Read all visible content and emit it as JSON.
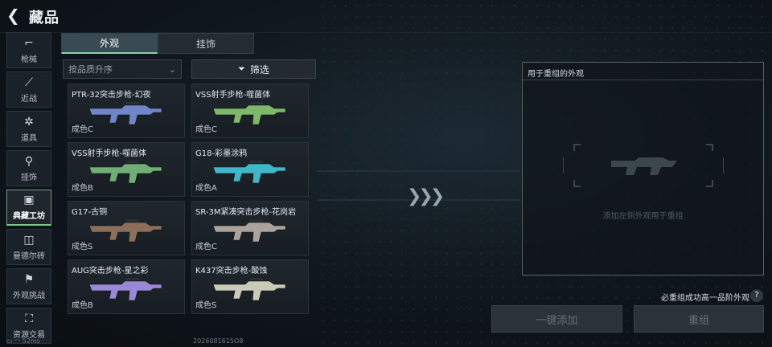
{
  "header": {
    "back_icon": "chevron-left-icon",
    "title": "藏品"
  },
  "sidebar": {
    "items": [
      {
        "label": "枪械",
        "icon": "pistol-icon",
        "glyph": "⌐"
      },
      {
        "label": "近战",
        "icon": "knife-icon",
        "glyph": "⟋"
      },
      {
        "label": "道具",
        "icon": "grenades-icon",
        "glyph": "✲"
      },
      {
        "label": "挂饰",
        "icon": "charm-icon",
        "glyph": "⚲"
      },
      {
        "label": "典藏工坊",
        "icon": "workshop-icon",
        "glyph": "▣"
      },
      {
        "label": "曼德尔砖",
        "icon": "brick-icon",
        "glyph": "◫"
      },
      {
        "label": "外观挑战",
        "icon": "challenge-icon",
        "glyph": "⚑"
      },
      {
        "label": "资源交易",
        "icon": "trade-icon",
        "glyph": "⛶"
      }
    ],
    "active_index": 4
  },
  "tabs": [
    {
      "label": "外观"
    },
    {
      "label": "挂饰"
    }
  ],
  "sort": {
    "value": "按品质升序"
  },
  "filter": {
    "label": "筛选"
  },
  "items": [
    {
      "name": "PTR-32突击步枪-幻夜",
      "quality": "成色C",
      "color": "#6f86c9"
    },
    {
      "name": "VSS射手步枪-噬菌体",
      "quality": "成色C",
      "color": "#7fb86b"
    },
    {
      "name": "VSS射手步枪-噬菌体",
      "quality": "成色B",
      "color": "#6fae76"
    },
    {
      "name": "G18-彩墨涂鸦",
      "quality": "成色A",
      "color": "#3fb7c8"
    },
    {
      "name": "G17-古铜",
      "quality": "成色S",
      "color": "#8c6e5a"
    },
    {
      "name": "SR-3M紧凑突击步枪-花岗岩",
      "quality": "成色C",
      "color": "#a9a39b"
    },
    {
      "name": "AUG突击步枪-星之彩",
      "quality": "成色B",
      "color": "#9a88d6"
    },
    {
      "name": "K437突击步枪-酸蚀",
      "quality": "成色S",
      "color": "#c9cbb8"
    }
  ],
  "panel": {
    "title": "用于重组的外观",
    "hint": "添加左侧外观用于重组"
  },
  "note": "必重组成功高一品阶外观",
  "buttons": {
    "add": "一键添加",
    "recombine": "重组"
  },
  "footer": {
    "ping": "52ms",
    "code": "2026081615O8"
  }
}
